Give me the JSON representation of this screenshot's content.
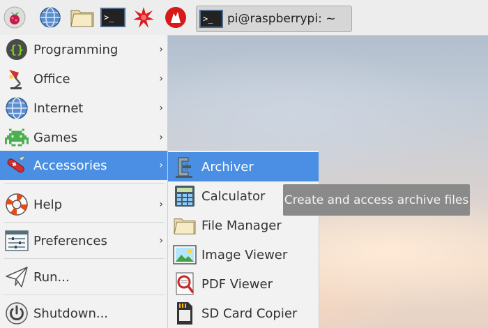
{
  "taskbar": {
    "launchers": [
      {
        "icon": "raspberry-icon"
      },
      {
        "icon": "globe-icon"
      },
      {
        "icon": "folder-icon"
      },
      {
        "icon": "terminal-icon"
      },
      {
        "icon": "wolfram-icon"
      },
      {
        "icon": "mathematica-icon"
      }
    ],
    "task_window": {
      "icon": "terminal-icon",
      "label": "pi@raspberrypi: ~"
    }
  },
  "main_menu": {
    "items": [
      {
        "label": "Programming",
        "icon": "programming-icon",
        "has_submenu": true
      },
      {
        "label": "Office",
        "icon": "office-lamp-icon",
        "has_submenu": true
      },
      {
        "label": "Internet",
        "icon": "globe-icon",
        "has_submenu": true
      },
      {
        "label": "Games",
        "icon": "space-invader-icon",
        "has_submenu": true
      },
      {
        "label": "Accessories",
        "icon": "swiss-knife-icon",
        "has_submenu": true,
        "selected": true
      },
      {
        "label": "Help",
        "icon": "lifebuoy-icon",
        "has_submenu": true
      },
      {
        "label": "Preferences",
        "icon": "preferences-icon",
        "has_submenu": true
      },
      {
        "label": "Run...",
        "icon": "paper-plane-icon",
        "has_submenu": false
      },
      {
        "label": "Shutdown...",
        "icon": "power-icon",
        "has_submenu": false
      }
    ],
    "arrow": "›"
  },
  "sub_menu": {
    "items": [
      {
        "label": "Archiver",
        "icon": "archiver-clamp-icon",
        "selected": true
      },
      {
        "label": "Calculator",
        "icon": "calculator-icon"
      },
      {
        "label": "File Manager",
        "icon": "folder-icon"
      },
      {
        "label": "Image Viewer",
        "icon": "image-viewer-icon"
      },
      {
        "label": "PDF Viewer",
        "icon": "pdf-viewer-icon"
      },
      {
        "label": "SD Card Copier",
        "icon": "sd-card-icon"
      }
    ]
  },
  "tooltip": {
    "text": "Create and access archive files"
  },
  "colors": {
    "selection": "#4a8fe3",
    "menu_bg": "#f2f2f2",
    "taskbar_bg": "#ededed",
    "tooltip_bg": "#8a8a8a"
  }
}
